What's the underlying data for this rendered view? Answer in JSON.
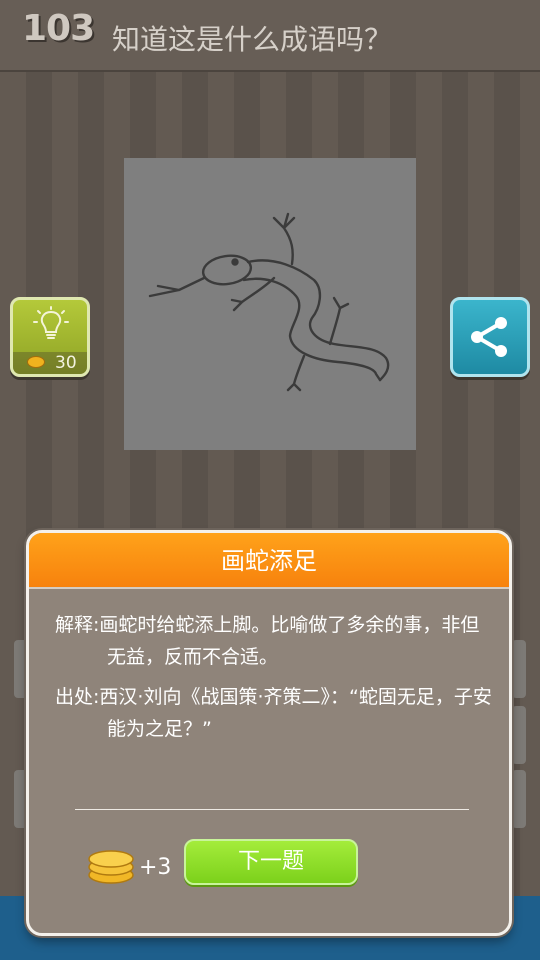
{
  "header": {
    "level": "103",
    "question": "知道这是什么成语吗？"
  },
  "hint": {
    "cost": "30",
    "icon": "lightbulb-icon"
  },
  "share": {
    "icon": "share-icon"
  },
  "dialog": {
    "title": "画蛇添足",
    "explanation_label": "解释:",
    "explanation_text": "画蛇时给蛇添上脚。比喻做了多余的事，非但无益，反而不合适。",
    "source_label": "出处:",
    "source_text": "西汉·刘向《战国策·齐策二》：“蛇固无足，子安能为之足？”",
    "reward": "+3",
    "next_label": "下一题"
  },
  "colors": {
    "title_orange": "#f7820d",
    "next_green": "#86d61f",
    "hint_green": "#a5bb2e",
    "share_blue": "#2ea3bd"
  }
}
